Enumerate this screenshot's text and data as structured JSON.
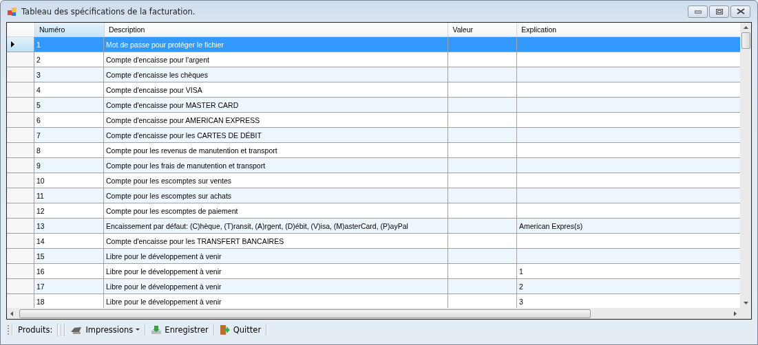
{
  "window": {
    "title": "Tableau des spécifications de la facturation."
  },
  "table": {
    "columns": [
      "Numéro",
      "Description",
      "Valeur",
      "Explication"
    ],
    "rows": [
      {
        "cells": [
          "1",
          "Mot de passe pour protéger le fichier",
          "",
          ""
        ],
        "selected": true
      },
      {
        "cells": [
          "2",
          "Compte d'encaisse pour l'argent",
          "",
          ""
        ],
        "selected": false
      },
      {
        "cells": [
          "3",
          "Compte d'encaisse les chèques",
          "",
          ""
        ],
        "selected": false
      },
      {
        "cells": [
          "4",
          "Compte d'encaisse pour VISA",
          "",
          ""
        ],
        "selected": false
      },
      {
        "cells": [
          "5",
          "Compte d'encaisse pour MASTER CARD",
          "",
          ""
        ],
        "selected": false
      },
      {
        "cells": [
          "6",
          "Compte d'encaisse pour AMERICAN EXPRESS",
          "",
          ""
        ],
        "selected": false
      },
      {
        "cells": [
          "7",
          "Compte d'encaisse pour les CARTES DE DÉBIT",
          "",
          ""
        ],
        "selected": false
      },
      {
        "cells": [
          "8",
          "Compte pour les revenus de manutention et transport",
          "",
          ""
        ],
        "selected": false
      },
      {
        "cells": [
          "9",
          "Compte pour les frais de manutention et transport",
          "",
          ""
        ],
        "selected": false
      },
      {
        "cells": [
          "10",
          "Compte pour les escomptes sur ventes",
          "",
          ""
        ],
        "selected": false
      },
      {
        "cells": [
          "11",
          "Compte pour les escomptes sur achats",
          "",
          ""
        ],
        "selected": false
      },
      {
        "cells": [
          "12",
          "Compte pour les escomptes de paiement",
          "",
          ""
        ],
        "selected": false
      },
      {
        "cells": [
          "13",
          "Encaissement par défaut: (C)hèque, (T)ransit, (A)rgent, (D)ébit, (V)isa, (M)asterCard, (P)ayPal",
          "",
          "American Expres(s)"
        ],
        "selected": false
      },
      {
        "cells": [
          "14",
          "Compte d'encaisse pour les TRANSFERT BANCAIRES",
          "",
          ""
        ],
        "selected": false
      },
      {
        "cells": [
          "15",
          "Libre pour le développement à venir",
          "",
          ""
        ],
        "selected": false
      },
      {
        "cells": [
          "16",
          "Libre pour le développement à venir",
          "",
          "1"
        ],
        "selected": false
      },
      {
        "cells": [
          "17",
          "Libre pour le développement à venir",
          "",
          "2"
        ],
        "selected": false
      },
      {
        "cells": [
          "18",
          "Libre pour le développement à venir",
          "",
          "3"
        ],
        "selected": false
      }
    ]
  },
  "toolbar": {
    "label": "Produits:",
    "buttons": [
      {
        "kind": "print",
        "label": "Impressions",
        "dropdown": true
      },
      {
        "kind": "save",
        "label": "Enregistrer",
        "dropdown": false
      },
      {
        "kind": "exit",
        "label": "Quitter",
        "dropdown": false
      }
    ]
  }
}
